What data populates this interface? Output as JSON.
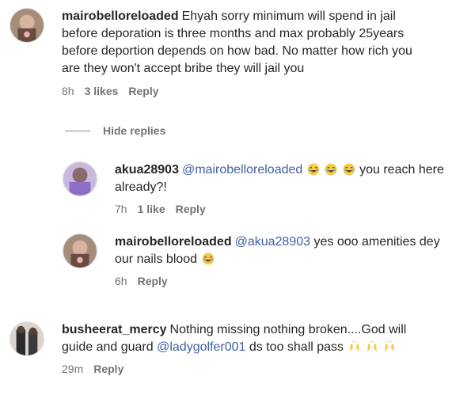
{
  "comments": [
    {
      "username": "mairobelloreloaded",
      "text": "Ehyah sorry minimum will spend in jail before deporation is three months and max probably 25years before deportion depends on how bad. No matter how rich you are they won't accept bribe they will jail you",
      "time": "8h",
      "likes": "3 likes",
      "reply": "Reply"
    }
  ],
  "hide_replies_label": "Hide replies",
  "replies": [
    {
      "username": "akua28903",
      "mention": "@mairobelloreloaded",
      "text_after": "you reach here already?!",
      "time": "7h",
      "likes": "1 like",
      "reply": "Reply"
    },
    {
      "username": "mairobelloreloaded",
      "mention": "@akua28903",
      "text_after": "yes ooo amenities dey our nails blood",
      "time": "6h",
      "reply": "Reply"
    }
  ],
  "bottom_comment": {
    "username": "busheerat_mercy",
    "text_before": "Nothing missing nothing broken....God will guide and guard",
    "mention": "@ladygolfer001",
    "text_after": "ds too shall pass",
    "time": "29m",
    "reply": "Reply"
  },
  "colors": {
    "mention": "#3f5fa5",
    "secondary_text": "#737373",
    "primary_text": "#262626"
  },
  "icons": [
    "laughing-emoji-icon",
    "raised-hands-emoji-icon"
  ]
}
